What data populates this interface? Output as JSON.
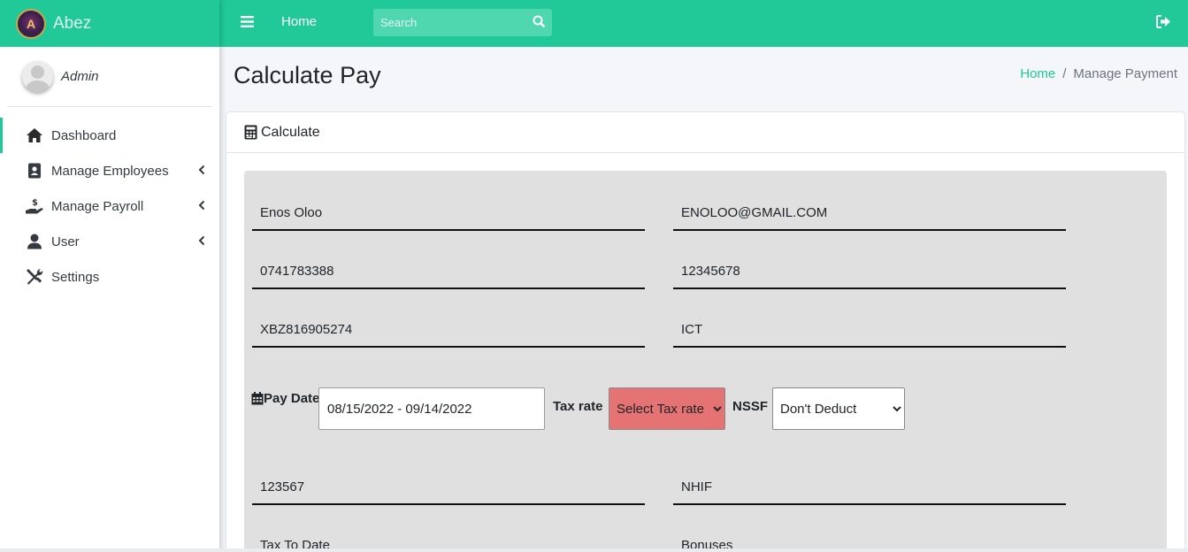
{
  "brand": {
    "name": "Abez",
    "logo_letter": "A"
  },
  "user": {
    "name": "Admin"
  },
  "sidebar": {
    "items": [
      {
        "label": "Dashboard",
        "icon": "home-icon"
      },
      {
        "label": "Manage Employees",
        "icon": "id-card-icon"
      },
      {
        "label": "Manage Payroll",
        "icon": "hand-dollar-icon"
      },
      {
        "label": "User",
        "icon": "user-icon"
      },
      {
        "label": "Settings",
        "icon": "tools-icon"
      }
    ]
  },
  "topbar": {
    "home_label": "Home",
    "search_placeholder": "Search"
  },
  "page": {
    "title": "Calculate Pay"
  },
  "breadcrumb": {
    "home": "Home",
    "separator": "/",
    "current": "Manage Payment"
  },
  "card": {
    "title": "Calculate"
  },
  "form": {
    "name": "Enos Oloo",
    "email": "ENOLOO@GMAIL.COM",
    "phone": "0741783388",
    "id_number": "12345678",
    "pin": "XBZ816905274",
    "department": "ICT",
    "pay_date_label": "Pay Date",
    "pay_date_value": "08/15/2022 - 09/14/2022",
    "tax_rate_label": "Tax rate",
    "tax_rate_selected": "Select Tax rate",
    "nssf_label": "NSSF",
    "nssf_selected": "Don't Deduct",
    "nssf_number": "123567",
    "nhif": "NHIF",
    "tax_to_date": "Tax To Date",
    "bonuses": "Bonuses"
  },
  "colors": {
    "accent": "#20c997",
    "tax_select_bg": "#e57373",
    "form_bg": "#e0e0e0"
  }
}
